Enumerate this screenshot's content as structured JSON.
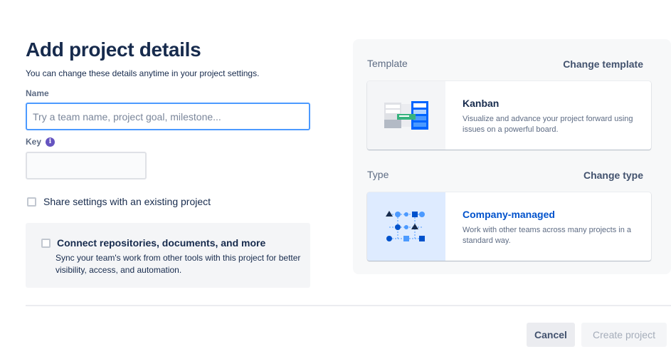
{
  "form": {
    "title": "Add project details",
    "subtitle": "You can change these details anytime in your project settings.",
    "name_label": "Name",
    "name_placeholder": "Try a team name, project goal, milestone...",
    "name_value": "",
    "key_label": "Key",
    "key_value": "",
    "share_label": "Share settings with an existing project",
    "connect": {
      "title": "Connect repositories, documents, and more",
      "description": "Sync your team's work from other tools with this project for better visibility, access, and automation."
    }
  },
  "panel": {
    "template": {
      "section_label": "Template",
      "change_label": "Change template",
      "card_title": "Kanban",
      "card_description": "Visualize and advance your project forward using issues on a powerful board.",
      "icon": "kanban-board-illustration"
    },
    "type": {
      "section_label": "Type",
      "change_label": "Change type",
      "card_title": "Company-managed",
      "card_description": "Work with other teams across many projects in a standard way.",
      "icon": "company-managed-illustration"
    }
  },
  "footer": {
    "cancel_label": "Cancel",
    "create_label": "Create project"
  },
  "colors": {
    "focus_border": "#4c9aff",
    "link_blue": "#0052cc",
    "info_purple": "#6554c0"
  }
}
